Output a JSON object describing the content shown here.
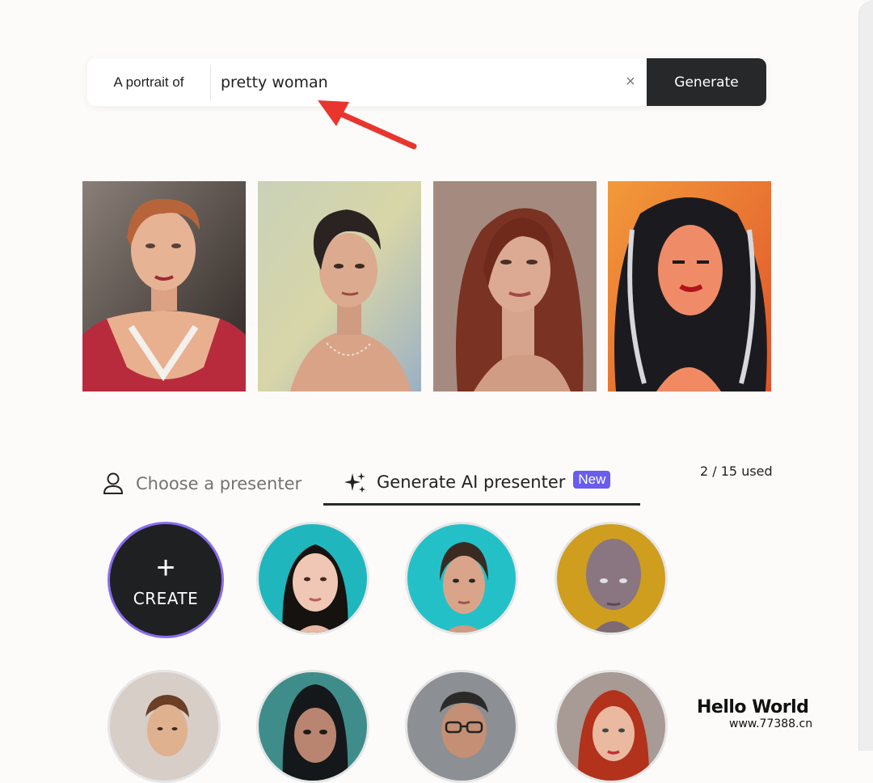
{
  "prompt": {
    "prefix": "A portrait of",
    "value": "pretty woman",
    "clear_icon": "×",
    "generate_label": "Generate"
  },
  "portraits": [
    {
      "description_icon": "portrait-1"
    },
    {
      "description_icon": "portrait-2"
    },
    {
      "description_icon": "portrait-3"
    },
    {
      "description_icon": "portrait-4"
    }
  ],
  "tabs": [
    {
      "label": "Choose a presenter",
      "icon": "person-icon",
      "active": false
    },
    {
      "label": "Generate AI presenter",
      "icon": "sparkle-icon",
      "active": true,
      "badge": "New"
    }
  ],
  "usage": "2 / 15 used",
  "create": {
    "plus": "+",
    "label": "CREATE"
  },
  "watermark": {
    "line1": "Hello World",
    "line2": "www.77388.cn"
  },
  "colors": {
    "accent": "#6b5cf0",
    "button": "#262829",
    "arrow": "#e8352e"
  }
}
